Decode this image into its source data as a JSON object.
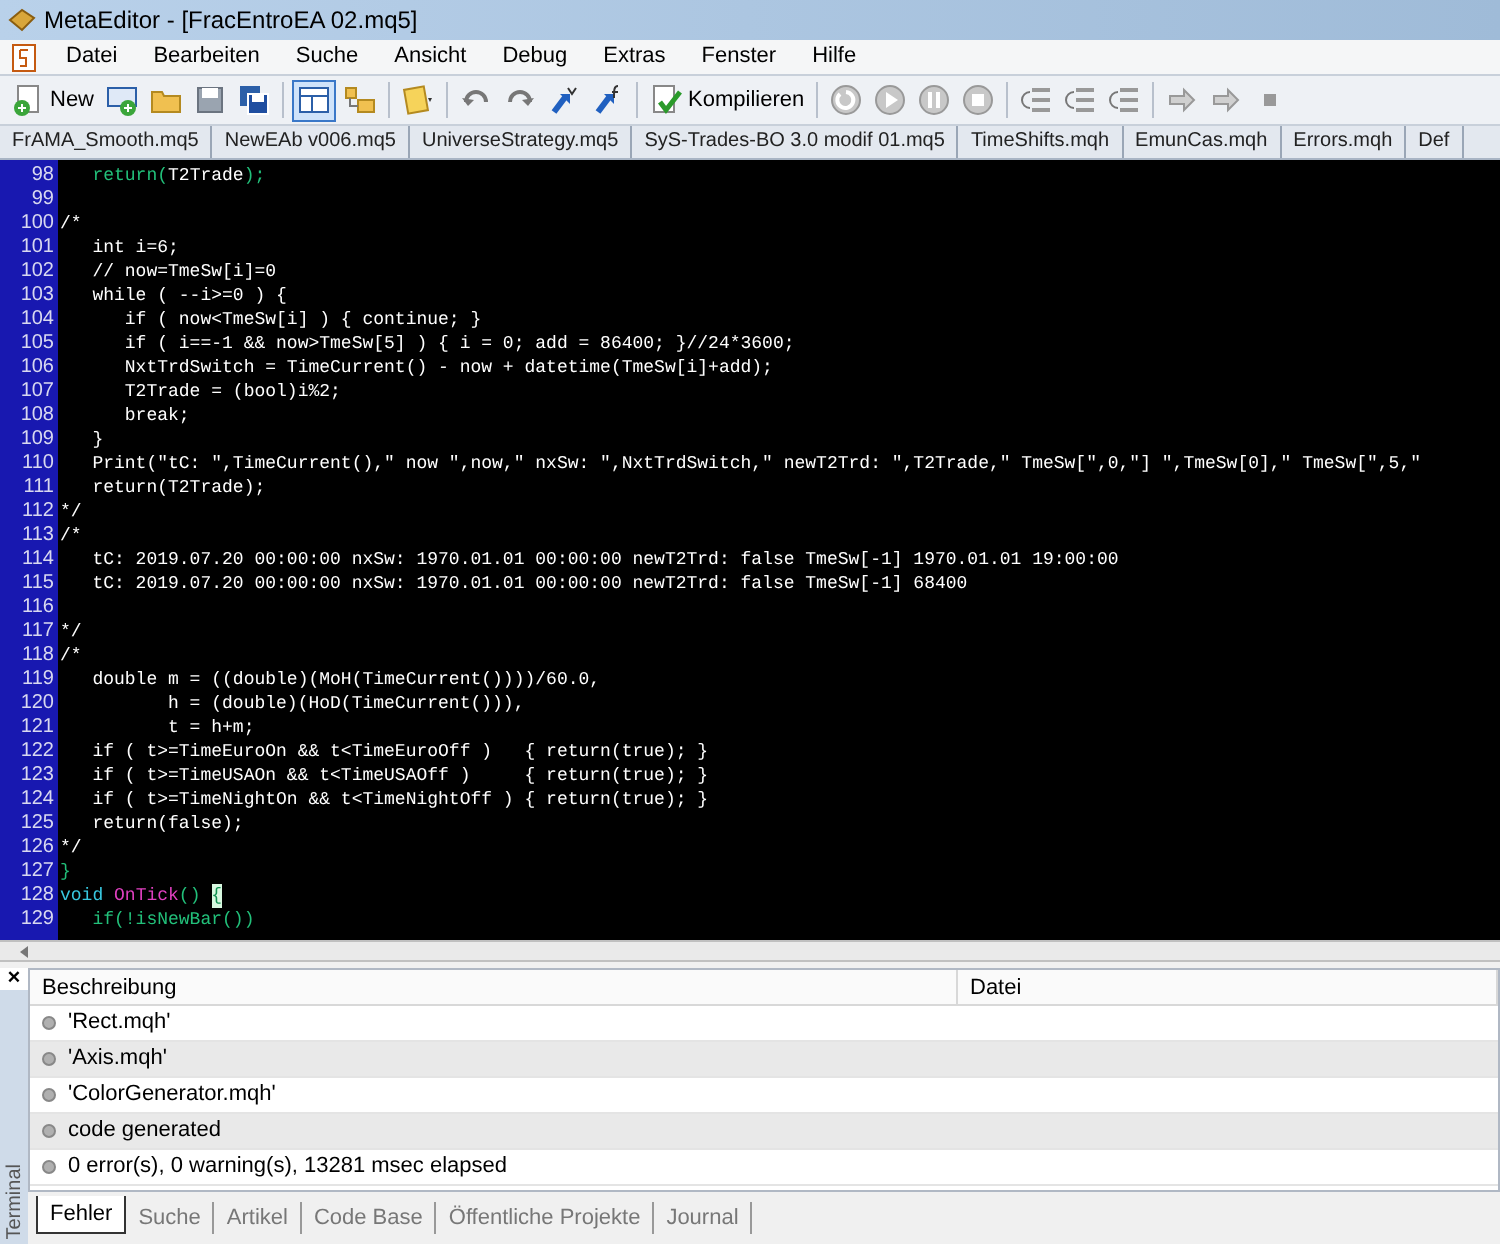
{
  "window": {
    "title": "MetaEditor - [FracEntroEA 02.mq5]"
  },
  "menu": [
    "Datei",
    "Bearbeiten",
    "Suche",
    "Ansicht",
    "Debug",
    "Extras",
    "Fenster",
    "Hilfe"
  ],
  "toolbar": [
    {
      "kind": "labeled",
      "label": "New"
    },
    {
      "kind": "icon"
    },
    {
      "kind": "icon"
    },
    {
      "kind": "icon"
    },
    {
      "kind": "icon"
    },
    {
      "kind": "sep"
    },
    {
      "kind": "icon",
      "pressed": true
    },
    {
      "kind": "icon",
      "pressed": false
    },
    {
      "kind": "sep"
    },
    {
      "kind": "icon"
    },
    {
      "kind": "sep"
    },
    {
      "kind": "icon"
    },
    {
      "kind": "icon"
    },
    {
      "kind": "icon"
    },
    {
      "kind": "icon"
    },
    {
      "kind": "sep"
    },
    {
      "kind": "labeled",
      "label": "Kompilieren"
    },
    {
      "kind": "sep"
    },
    {
      "kind": "icon"
    },
    {
      "kind": "icon"
    },
    {
      "kind": "icon"
    },
    {
      "kind": "icon"
    },
    {
      "kind": "sep"
    },
    {
      "kind": "icon"
    },
    {
      "kind": "icon"
    },
    {
      "kind": "icon"
    },
    {
      "kind": "sep"
    },
    {
      "kind": "icon"
    },
    {
      "kind": "icon"
    },
    {
      "kind": "icon"
    }
  ],
  "file_tabs": [
    "FrAMA_Smooth.mq5",
    "NewEAb v006.mq5",
    "UniverseStrategy.mq5",
    "SyS-Trades-BO 3.0 modif 01.mq5",
    "TimeShifts.mqh",
    "EmunCas.mqh",
    "Errors.mqh",
    "Def"
  ],
  "editor": {
    "lines": [
      {
        "number": "98",
        "segments": [
          {
            "kind": "keyword",
            "text": "   return("
          },
          {
            "kind": "plain",
            "text": "T2Trade"
          },
          {
            "kind": "keyword",
            "text": ");"
          }
        ]
      },
      {
        "number": "99"
      },
      {
        "number": "100",
        "segments": [
          {
            "kind": "plain",
            "text": "/*"
          }
        ]
      },
      {
        "number": "101",
        "segments": [
          {
            "kind": "plain",
            "text": "   int i=6;"
          }
        ]
      },
      {
        "number": "102",
        "segments": [
          {
            "kind": "plain",
            "text": "   // now=TmeSw[i]=0"
          }
        ]
      },
      {
        "number": "103",
        "segments": [
          {
            "kind": "plain",
            "text": "   while ( --i>=0 ) {"
          }
        ]
      },
      {
        "number": "104",
        "segments": [
          {
            "kind": "plain",
            "text": "      if ( now<TmeSw[i] ) { continue; }"
          }
        ]
      },
      {
        "number": "105",
        "segments": [
          {
            "kind": "plain",
            "text": "      if ( i==-1 && now>TmeSw[5] ) { i = 0; add = 86400; }//24*3600;"
          }
        ]
      },
      {
        "number": "106",
        "segments": [
          {
            "kind": "plain",
            "text": "      NxtTrdSwitch = TimeCurrent() - now + datetime(TmeSw[i]+add);"
          }
        ]
      },
      {
        "number": "107",
        "segments": [
          {
            "kind": "plain",
            "text": "      T2Trade = (bool)i%2;"
          }
        ]
      },
      {
        "number": "108",
        "segments": [
          {
            "kind": "plain",
            "text": "      break;"
          }
        ]
      },
      {
        "number": "109",
        "segments": [
          {
            "kind": "plain",
            "text": "   }"
          }
        ]
      },
      {
        "number": "110",
        "segments": [
          {
            "kind": "plain",
            "text": "   Print(\"tC: \",TimeCurrent(),\" now \",now,\" nxSw: \",NxtTrdSwitch,\" newT2Trd: \",T2Trade,\" TmeSw[\",0,\"] \",TmeSw[0],\" TmeSw[\",5,\""
          }
        ]
      },
      {
        "number": "111",
        "segments": [
          {
            "kind": "plain",
            "text": "   return(T2Trade);"
          }
        ]
      },
      {
        "number": "112",
        "segments": [
          {
            "kind": "plain",
            "text": "*/"
          }
        ]
      },
      {
        "number": "113",
        "segments": [
          {
            "kind": "plain",
            "text": "/*"
          }
        ]
      },
      {
        "number": "114",
        "segments": [
          {
            "kind": "plain",
            "text": "   tC: 2019.07.20 00:00:00 nxSw: 1970.01.01 00:00:00 newT2Trd: false TmeSw[-1] 1970.01.01 19:00:00"
          }
        ]
      },
      {
        "number": "115",
        "segments": [
          {
            "kind": "plain",
            "text": "   tC: 2019.07.20 00:00:00 nxSw: 1970.01.01 00:00:00 newT2Trd: false TmeSw[-1] 68400"
          }
        ]
      },
      {
        "number": "116"
      },
      {
        "number": "117",
        "segments": [
          {
            "kind": "plain",
            "text": "*/"
          }
        ]
      },
      {
        "number": "118",
        "segments": [
          {
            "kind": "plain",
            "text": "/*"
          }
        ]
      },
      {
        "number": "119",
        "segments": [
          {
            "kind": "plain",
            "text": "   double m = ((double)(MoH(TimeCurrent())))/60.0,"
          }
        ]
      },
      {
        "number": "120",
        "segments": [
          {
            "kind": "plain",
            "text": "          h = (double)(HoD(TimeCurrent())),"
          }
        ]
      },
      {
        "number": "121",
        "segments": [
          {
            "kind": "plain",
            "text": "          t = h+m;"
          }
        ]
      },
      {
        "number": "122",
        "segments": [
          {
            "kind": "plain",
            "text": "   if ( t>=TimeEuroOn && t<TimeEuroOff )   { return(true); }"
          }
        ]
      },
      {
        "number": "123",
        "segments": [
          {
            "kind": "plain",
            "text": "   if ( t>=TimeUSAOn && t<TimeUSAOff )     { return(true); }"
          }
        ]
      },
      {
        "number": "124",
        "segments": [
          {
            "kind": "plain",
            "text": "   if ( t>=TimeNightOn && t<TimeNightOff ) { return(true); }"
          }
        ]
      },
      {
        "number": "125",
        "segments": [
          {
            "kind": "plain",
            "text": "   return(false);"
          }
        ]
      },
      {
        "number": "126",
        "segments": [
          {
            "kind": "plain",
            "text": "*/"
          }
        ]
      },
      {
        "number": "127",
        "segments": [
          {
            "kind": "keyword",
            "text": "}"
          }
        ]
      },
      {
        "number": "128",
        "segments": [
          {
            "kind": "type",
            "text": "void "
          },
          {
            "kind": "function",
            "text": "OnTick"
          },
          {
            "kind": "keyword",
            "text": "() "
          },
          {
            "kind": "cursor",
            "text": "{"
          }
        ]
      },
      {
        "number": "129",
        "segments": [
          {
            "kind": "keyword",
            "text": "   if(!isNewBar())"
          }
        ]
      }
    ]
  },
  "terminal": {
    "title": "Terminal",
    "close": "×",
    "columns": [
      "Beschreibung",
      "Datei"
    ],
    "rows": [
      "'Rect.mqh'",
      "'Axis.mqh'",
      "'ColorGenerator.mqh'",
      "code generated",
      "0 error(s), 0 warning(s), 13281 msec elapsed"
    ],
    "tabs": [
      {
        "label": "Fehler",
        "selected": true
      },
      {
        "label": "Suche",
        "selected": false
      },
      {
        "label": "Artikel",
        "selected": false
      },
      {
        "label": "Code Base",
        "selected": false
      },
      {
        "label": "Öffentliche Projekte",
        "selected": false
      },
      {
        "label": "Journal",
        "selected": false
      }
    ]
  }
}
